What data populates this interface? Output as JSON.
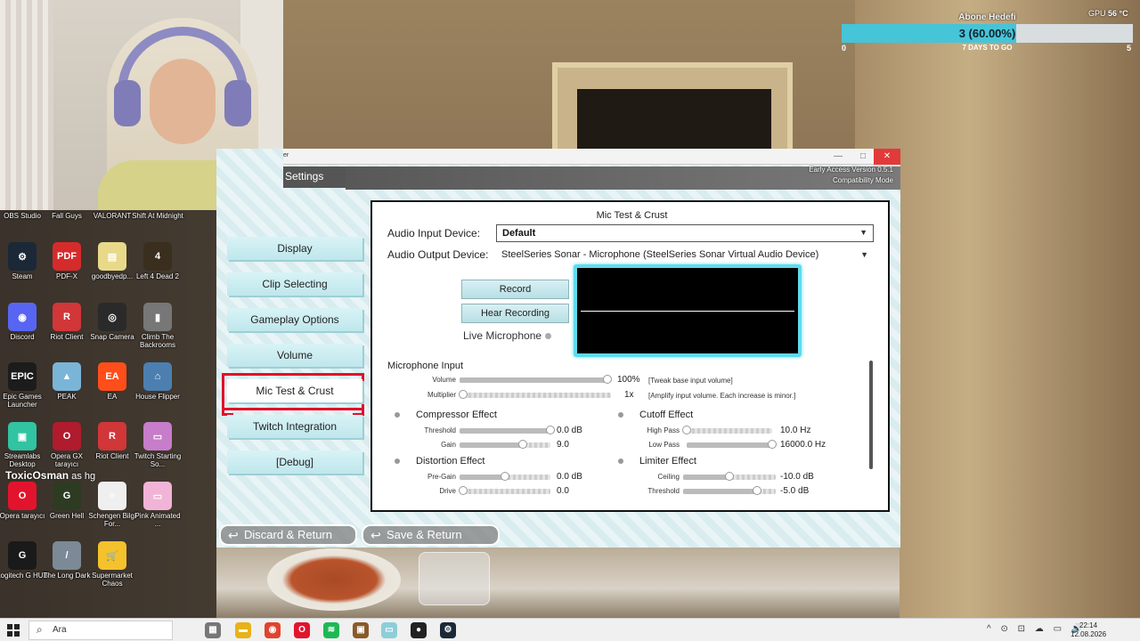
{
  "desktop": {
    "icons": [
      {
        "label": "OBS Studio",
        "icon": "obs-icon",
        "color": "#2b2b2b",
        "glyph": "●"
      },
      {
        "label": "Fall Guys",
        "icon": "fall-guys-icon",
        "color": "#5b8bd6",
        "glyph": "FG"
      },
      {
        "label": "VALORANT",
        "icon": "valorant-icon",
        "color": "#e84a57",
        "glyph": "V"
      },
      {
        "label": "Shift At Midnight",
        "icon": "shift-at-midnight-icon",
        "color": "#444444",
        "glyph": "S"
      },
      {
        "label": "Steam",
        "icon": "steam-icon",
        "color": "#1b2838",
        "glyph": "⚙"
      },
      {
        "label": "PDF-X",
        "icon": "pdf-x-icon",
        "color": "#d62b2b",
        "glyph": "PDF"
      },
      {
        "label": "goodbyedp...",
        "icon": "file-icon",
        "color": "#e8d98a",
        "glyph": "▤"
      },
      {
        "label": "Left 4 Dead 2",
        "icon": "left4dead-icon",
        "color": "#3a2f1e",
        "glyph": "4"
      },
      {
        "label": "Discord",
        "icon": "discord-icon",
        "color": "#5865f2",
        "glyph": "◉"
      },
      {
        "label": "Riot Client",
        "icon": "riot-icon",
        "color": "#d13639",
        "glyph": "R"
      },
      {
        "label": "Snap Camera",
        "icon": "snap-camera-icon",
        "color": "#2a2a2a",
        "glyph": "◎"
      },
      {
        "label": "Climb The Backrooms",
        "icon": "climb-backrooms-icon",
        "color": "#777777",
        "glyph": "▮"
      },
      {
        "label": "Epic Games Launcher",
        "icon": "epic-games-icon",
        "color": "#1c1c1c",
        "glyph": "EPIC"
      },
      {
        "label": "PEAK",
        "icon": "peak-icon",
        "color": "#7ab5d8",
        "glyph": "▲"
      },
      {
        "label": "EA",
        "icon": "ea-icon",
        "color": "#ff4e1a",
        "glyph": "EA"
      },
      {
        "label": "House Flipper",
        "icon": "house-flipper-icon",
        "color": "#4c7fb0",
        "glyph": "⌂"
      },
      {
        "label": "Streamlabs Desktop",
        "icon": "streamlabs-icon",
        "color": "#31c3a2",
        "glyph": "▣"
      },
      {
        "label": "Opera GX tarayıcı",
        "icon": "opera-gx-icon",
        "color": "#b01b2e",
        "glyph": "O"
      },
      {
        "label": "Riot Client",
        "icon": "riot-icon",
        "color": "#d13639",
        "glyph": "R"
      },
      {
        "label": "Twitch Starting So...",
        "icon": "twitch-file-icon",
        "color": "#c77dc9",
        "glyph": "▭"
      },
      {
        "label": "Opera tarayıcı",
        "icon": "opera-icon",
        "color": "#e2142d",
        "glyph": "O"
      },
      {
        "label": "Green Hell",
        "icon": "green-hell-icon",
        "color": "#2d3b23",
        "glyph": "G"
      },
      {
        "label": "Schengen Bilgi For...",
        "icon": "document-icon",
        "color": "#efefef",
        "glyph": "≡"
      },
      {
        "label": "Pink Animated ...",
        "icon": "pink-animated-icon",
        "color": "#f2b4d6",
        "glyph": "▭"
      },
      {
        "label": "Logitech G HUB",
        "icon": "logitech-icon",
        "color": "#1a1a1a",
        "glyph": "G"
      },
      {
        "label": "The Long Dark",
        "icon": "the-long-dark-icon",
        "color": "#7b8a96",
        "glyph": "/"
      },
      {
        "label": "Supermarket Chaos",
        "icon": "supermarket-chaos-icon",
        "color": "#f3c22c",
        "glyph": "🛒"
      }
    ],
    "overlay_name": "ToxicOsman",
    "overlay_suffix": "as hg"
  },
  "overlay": {
    "goal_title": "Abone Hedefi",
    "goal_text": "3 (60.00%)",
    "goal_progress": 0.6,
    "goal_min": "0",
    "goal_days": "7 DAYS TO GO",
    "goal_max": "5",
    "gpu_label": "GPU",
    "gpu_value": "56 °C"
  },
  "window": {
    "title": "er",
    "minimize": "—",
    "maximize": "□",
    "close": "✕",
    "settings_tab": "Settings",
    "version_line1": "Early Access Version 0.5.1",
    "version_line2": "Compatibility Mode"
  },
  "nav": {
    "items": [
      "Display",
      "Clip Selecting",
      "Gameplay Options",
      "Volume",
      "Mic Test & Crust",
      "Twitch Integration",
      "[Debug]"
    ],
    "active_index": 4
  },
  "panel": {
    "title": "Mic Test & Crust",
    "input_label": "Audio Input Device:",
    "input_value": "Default",
    "output_label": "Audio Output Device:",
    "output_value": "SteelSeries Sonar - Microphone (SteelSeries Sonar Virtual Audio Device)",
    "record_label": "Record",
    "hear_label": "Hear Recording",
    "live_label": "Live Microphone",
    "mic_section": "Microphone Input",
    "volume_label": "Volume",
    "volume_value": "100%",
    "volume_level": 1.0,
    "volume_note": "[Tweak base input volume]",
    "multiplier_label": "Multiplier",
    "multiplier_value": "1x",
    "multiplier_level": 0.0,
    "multiplier_note": "[Amplify input volume. Each increase is minor.]",
    "compressor": {
      "title": "Compressor Effect",
      "threshold_label": "Threshold",
      "threshold_value": "0.0 dB",
      "threshold_level": 1.0,
      "gain_label": "Gain",
      "gain_value": "9.0",
      "gain_level": 0.7
    },
    "cutoff": {
      "title": "Cutoff Effect",
      "highpass_label": "High Pass",
      "highpass_value": "10.0 Hz",
      "highpass_level": 0.0,
      "lowpass_label": "Low Pass",
      "lowpass_value": "16000.0 Hz",
      "lowpass_level": 1.0
    },
    "distortion": {
      "title": "Distortion Effect",
      "pregain_label": "Pre-Gain",
      "pregain_value": "0.0 dB",
      "pregain_level": 0.5,
      "drive_label": "Drive",
      "drive_value": "0.0",
      "drive_level": 0.0
    },
    "limiter": {
      "title": "Limiter Effect",
      "ceiling_label": "Ceiling",
      "ceiling_value": "-10.0 dB",
      "ceiling_level": 0.5,
      "threshold_label": "Threshold",
      "threshold_value": "-5.0 dB",
      "threshold_level": 0.8
    }
  },
  "footer": {
    "discard_label": "Discard & Return",
    "save_label": "Save & Return",
    "arrow": "↩"
  },
  "taskbar": {
    "search_placeholder": "Ara",
    "time": "22:14",
    "date": "12.08.2026",
    "tray": "^ ⊙ ⊡ ☁ ▭ 🔊"
  }
}
